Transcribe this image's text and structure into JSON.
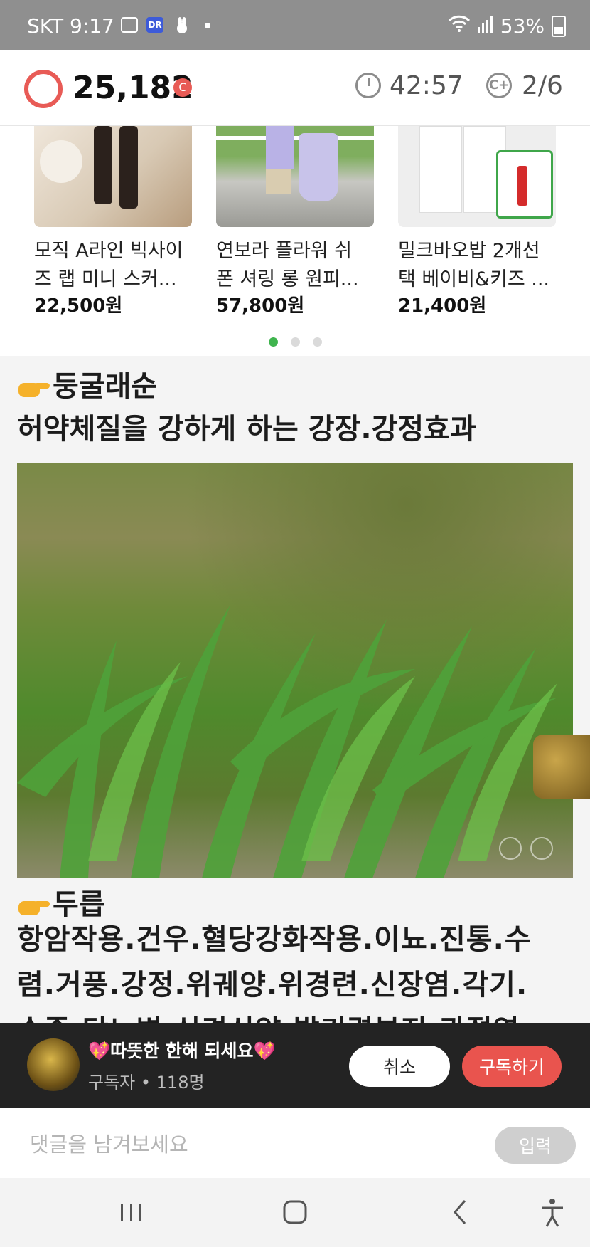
{
  "status_bar": {
    "carrier_time": "SKT 9:17",
    "badge": "DR",
    "battery": "53%",
    "icons": [
      "gallery-icon",
      "app-badge-icon",
      "rabbit-icon",
      "notification-dot-icon",
      "wifi-icon",
      "signal-icon",
      "battery-icon"
    ]
  },
  "header": {
    "points": "25,182",
    "points_badge": "C",
    "timer": "42:57",
    "page_count": "2/6",
    "coin_symbol": "C+"
  },
  "products": [
    {
      "name_line1": "모직 A라인 빅사이",
      "name_line2": "즈 랩 미니 스커...",
      "price": "22,500원"
    },
    {
      "name_line1": "연보라 플라워 쉬",
      "name_line2": "폰 셔링 롱 원피...",
      "price": "57,800원"
    },
    {
      "name_line1": "밀크바오밥 2개선",
      "name_line2": "택 베이비&키즈 ...",
      "price": "21,400원"
    }
  ],
  "carousel": {
    "pages": 3,
    "active": 1
  },
  "article": {
    "section1_title": "둥굴래순",
    "section1_subtitle": "허약체질을 강하게 하는 강장.강정효과",
    "section2_title": "두릅",
    "section2_line1": "항암작용.건우.혈당강화작용.이뇨.진통.수",
    "section2_line2": "렴.거풍.강정.위궤양.위경련.신장염.각기.",
    "section2_line3": "수종.당뇨병.신경쇠약.발기력부진.관절염"
  },
  "subscribe": {
    "title": "💖따뜻한 한해 되세요💖",
    "subscribers": "구독자 • 118명",
    "cancel_label": "취소",
    "subscribe_label": "구독하기"
  },
  "comment": {
    "placeholder": "댓글을 남겨보세요",
    "submit_label": "입력"
  },
  "colors": {
    "accent": "#e9544e",
    "carousel_active": "#3fb44e",
    "status_bar": "#8f8f8f"
  }
}
